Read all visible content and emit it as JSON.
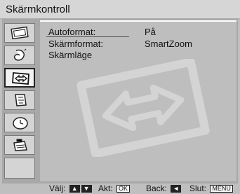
{
  "window": {
    "title": "Skärmkontroll"
  },
  "menu": {
    "icons": [
      "picture-adjust-icon",
      "sound-icon",
      "screen-control-icon",
      "setup-icon",
      "timer-icon",
      "options-icon"
    ],
    "selected_index": 2
  },
  "settings": [
    {
      "label": "Autoformat:",
      "value": "På"
    },
    {
      "label": "Skärmformat:",
      "value": "SmartZoom"
    },
    {
      "label": "Skärmläge",
      "value": ""
    }
  ],
  "footer": {
    "select_label": "Välj:",
    "select_keys": [
      "▲",
      "▼"
    ],
    "enter_label": "Akt:",
    "enter_key": "OK",
    "back_label": "Back:",
    "back_key": "◄",
    "exit_label": "Slut:",
    "exit_key": "MENU"
  }
}
